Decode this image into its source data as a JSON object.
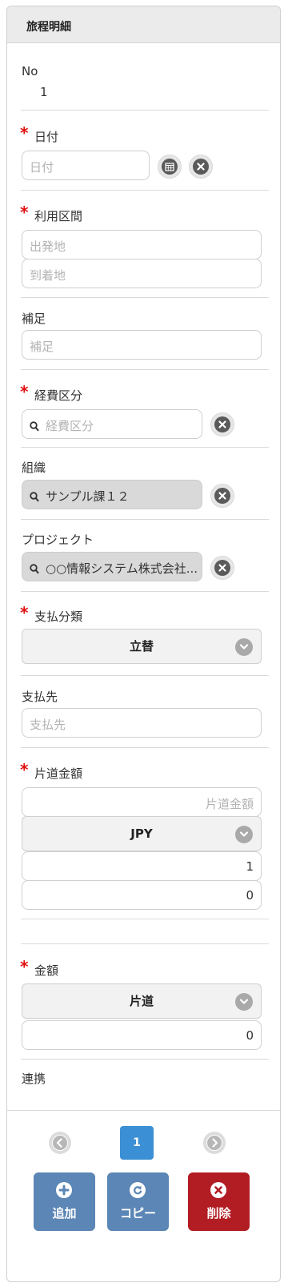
{
  "header": {
    "title": "旅程明細"
  },
  "no": {
    "label": "No",
    "value": "1"
  },
  "date": {
    "label": "日付",
    "placeholder": "日付"
  },
  "route": {
    "label": "利用区間",
    "from_placeholder": "出発地",
    "to_placeholder": "到着地"
  },
  "supplement": {
    "label": "補足",
    "placeholder": "補足"
  },
  "expense_category": {
    "label": "経費区分",
    "placeholder": "経費区分"
  },
  "organization": {
    "label": "組織",
    "value": "サンプル課１２"
  },
  "project": {
    "label": "プロジェクト",
    "value": "○○情報システム株式会社..."
  },
  "payment_class": {
    "label": "支払分類",
    "selected": "立替"
  },
  "payee": {
    "label": "支払先",
    "placeholder": "支払先"
  },
  "one_way_amount": {
    "label": "片道金額",
    "placeholder": "片道金額",
    "currency": "JPY",
    "rate": "1",
    "converted": "0"
  },
  "amount": {
    "label": "金額",
    "trip_type": "片道",
    "value": "0"
  },
  "link": {
    "label": "連携"
  },
  "pager": {
    "current_page": "1"
  },
  "actions": {
    "add_label": "追加",
    "copy_label": "コピー",
    "delete_label": "削除"
  },
  "colors": {
    "required": "#e01010",
    "page_active": "#3b8fd4",
    "btn_blue": "#5b86b5",
    "btn_red": "#b21d23"
  },
  "icons": {
    "calendar": "calendar-icon",
    "clear": "clear-icon",
    "search": "search-icon",
    "dropdown": "chevron-down-icon"
  }
}
